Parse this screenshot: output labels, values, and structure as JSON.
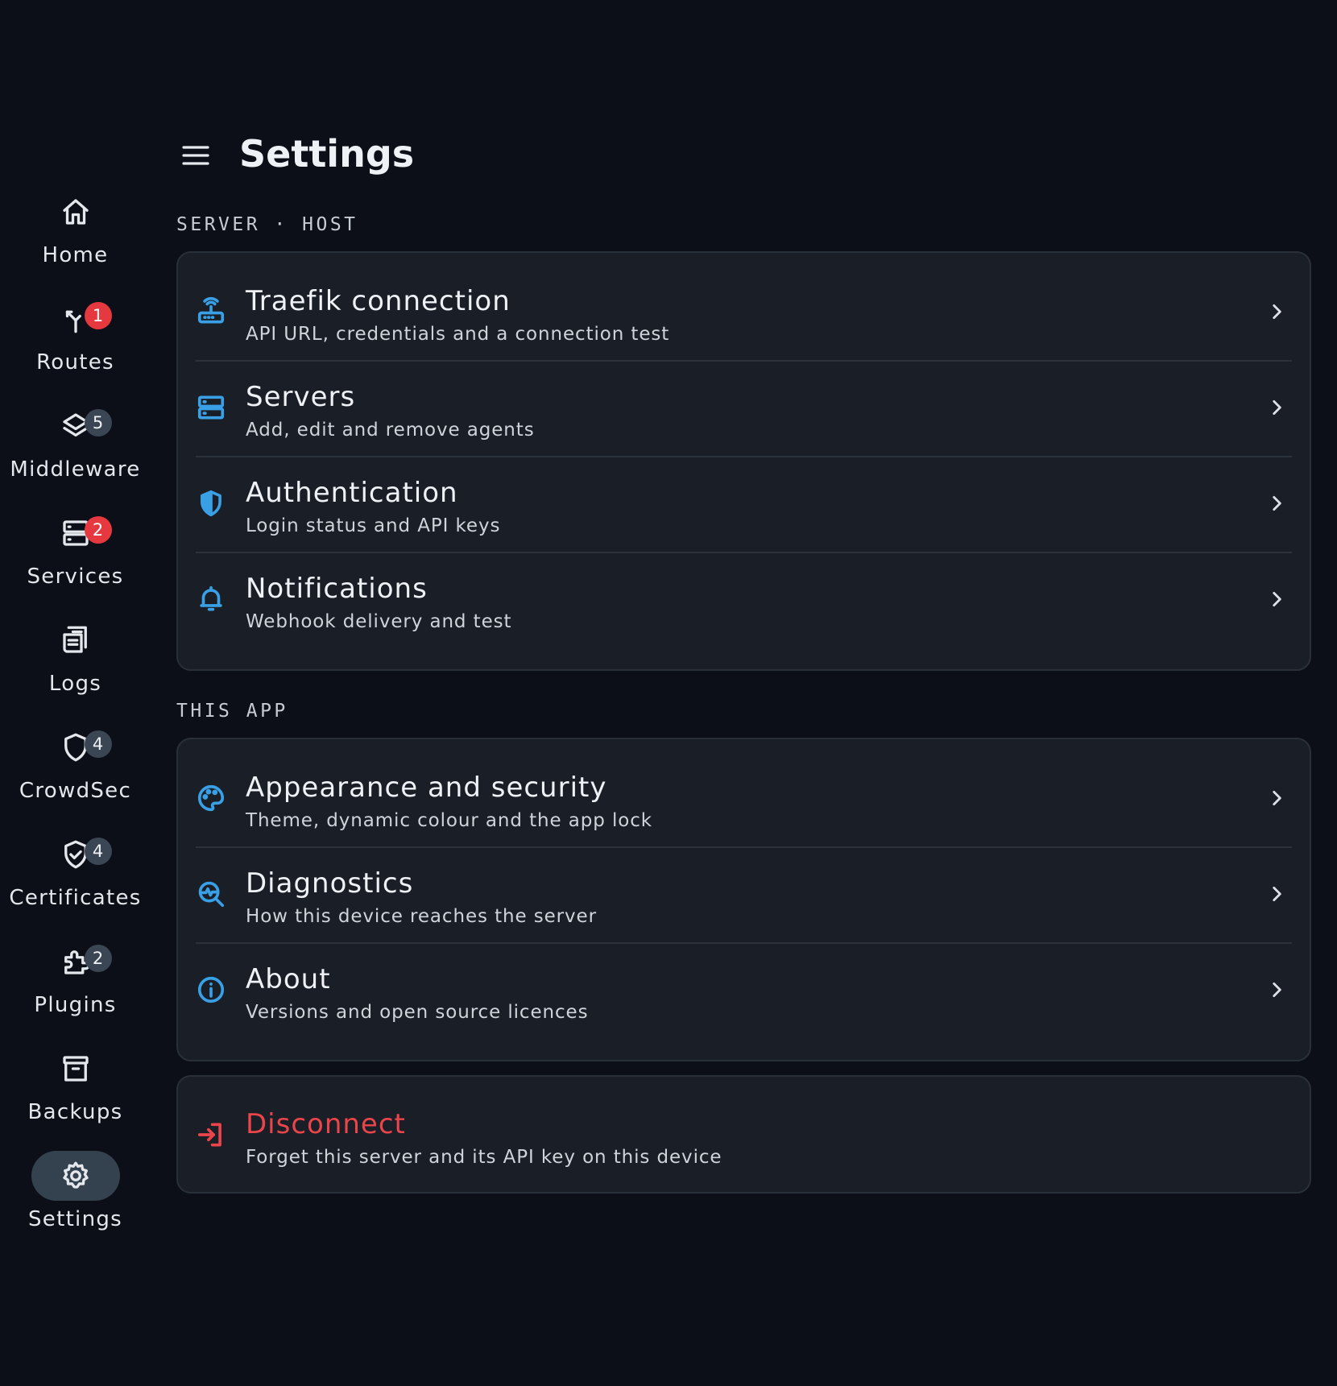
{
  "colors": {
    "background": "#0c0f17",
    "surface": "#1a1e26",
    "accent": "#3aa0e6",
    "danger": "#e9454a",
    "badge_error": "#e5393f",
    "badge_neutral": "#3a4654",
    "active_pill": "#34414f"
  },
  "header": {
    "menu_icon": "menu-icon",
    "title": "Settings"
  },
  "nav": {
    "items": [
      {
        "label": "Home",
        "icon": "home-icon",
        "badge": ""
      },
      {
        "label": "Routes",
        "icon": "routes-icon",
        "badge": "1"
      },
      {
        "label": "Middleware",
        "icon": "layers-icon",
        "badge": "5"
      },
      {
        "label": "Services",
        "icon": "server-icon",
        "badge": "2"
      },
      {
        "label": "Logs",
        "icon": "logs-icon",
        "badge": ""
      },
      {
        "label": "CrowdSec",
        "icon": "shield-icon",
        "badge": "4"
      },
      {
        "label": "Certificates",
        "icon": "shield-check-icon",
        "badge": "4"
      },
      {
        "label": "Plugins",
        "icon": "puzzle-icon",
        "badge": "2"
      },
      {
        "label": "Backups",
        "icon": "archive-icon",
        "badge": ""
      },
      {
        "label": "Settings",
        "icon": "gear-icon",
        "badge": "",
        "active": true
      }
    ]
  },
  "sections": {
    "server": {
      "label": "SERVER · HOST",
      "rows": [
        {
          "title": "Traefik connection",
          "subtitle": "API URL, credentials and a connection test",
          "icon": "router-icon"
        },
        {
          "title": "Servers",
          "subtitle": "Add, edit and remove agents",
          "icon": "dns-icon"
        },
        {
          "title": "Authentication",
          "subtitle": "Login status and API keys",
          "icon": "shield-half-icon"
        },
        {
          "title": "Notifications",
          "subtitle": "Webhook delivery and test",
          "icon": "bell-icon"
        }
      ]
    },
    "app": {
      "label": "THIS APP",
      "rows": [
        {
          "title": "Appearance and security",
          "subtitle": "Theme, dynamic colour and the app lock",
          "icon": "palette-icon"
        },
        {
          "title": "Diagnostics",
          "subtitle": "How this device reaches the server",
          "icon": "diagnostics-icon"
        },
        {
          "title": "About",
          "subtitle": "Versions and open source licences",
          "icon": "info-icon"
        }
      ]
    },
    "disconnect": {
      "title": "Disconnect",
      "subtitle": "Forget this server and its API key on this device",
      "icon": "logout-icon"
    }
  }
}
